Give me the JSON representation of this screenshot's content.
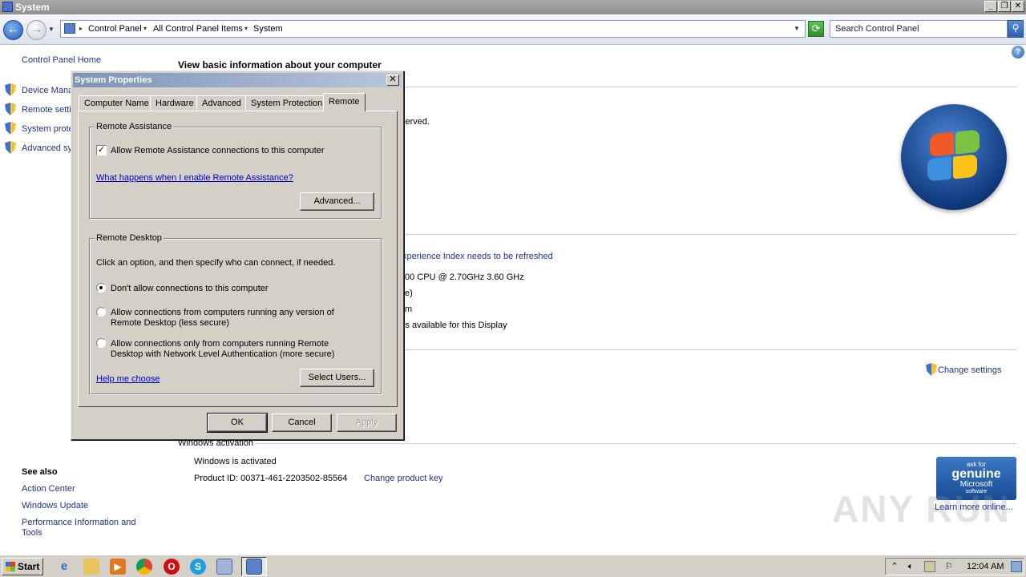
{
  "window": {
    "title": "System"
  },
  "address": {
    "crumbs": [
      "Control Panel",
      "All Control Panel Items",
      "System"
    ],
    "search_placeholder": "Search Control Panel"
  },
  "sidebar": {
    "home": "Control Panel Home",
    "items": [
      {
        "label": "Device Mana"
      },
      {
        "label": "Remote setti"
      },
      {
        "label": "System prote"
      },
      {
        "label": "Advanced sy"
      }
    ],
    "see_also_title": "See also",
    "see_also": [
      "Action Center",
      "Windows Update",
      "Performance Information and",
      "Tools"
    ]
  },
  "main": {
    "heading": "View basic information about your computer",
    "fragments": {
      "reserved": "served.",
      "experience": "xperience Index needs to be refreshed",
      "cpu": "00 CPU @ 2.70GHz   3.60 GHz",
      "f1": "e)",
      "f2": "m",
      "display": "is available for this Display"
    },
    "change_settings": "Change settings",
    "activation_title": "Windows activation",
    "activated": "Windows is activated",
    "product_id": "Product ID:  00371-461-2203502-85564",
    "change_product_key": "Change product key",
    "genuine": {
      "line1": "ask for",
      "line2": "genuine",
      "line3": "Microsoft",
      "line4": "software"
    },
    "learn_more": "Learn more online...",
    "watermark": "ANY RUN"
  },
  "dialog": {
    "title": "System Properties",
    "tabs": [
      "Computer Name",
      "Hardware",
      "Advanced",
      "System Protection",
      "Remote"
    ],
    "selected_tab": "Remote",
    "remote_assistance": {
      "label": "Remote Assistance",
      "checkbox_label": "Allow Remote Assistance connections to this computer",
      "checked": true,
      "help_link": "What happens when I enable Remote Assistance?",
      "advanced_button": "Advanced..."
    },
    "remote_desktop": {
      "label": "Remote Desktop",
      "instruction": "Click an option, and then specify who can connect, if needed.",
      "option1": "Don't allow connections to this computer",
      "option2_line1": "Allow connections from computers running any version of",
      "option2_line2": "Remote Desktop (less secure)",
      "option3_line1": "Allow connections only from computers running Remote",
      "option3_line2": "Desktop with Network Level Authentication (more secure)",
      "selected_option": 1,
      "help_link": "Help me choose",
      "select_users_button": "Select Users..."
    },
    "buttons": {
      "ok": "OK",
      "cancel": "Cancel",
      "apply": "Apply"
    }
  },
  "taskbar": {
    "start_label": "Start",
    "clock": "12:04 AM"
  },
  "colors": {
    "link": "#1e3287",
    "dialog_face": "#d4d0c8",
    "title_gradient_start": "#7d94b8"
  }
}
